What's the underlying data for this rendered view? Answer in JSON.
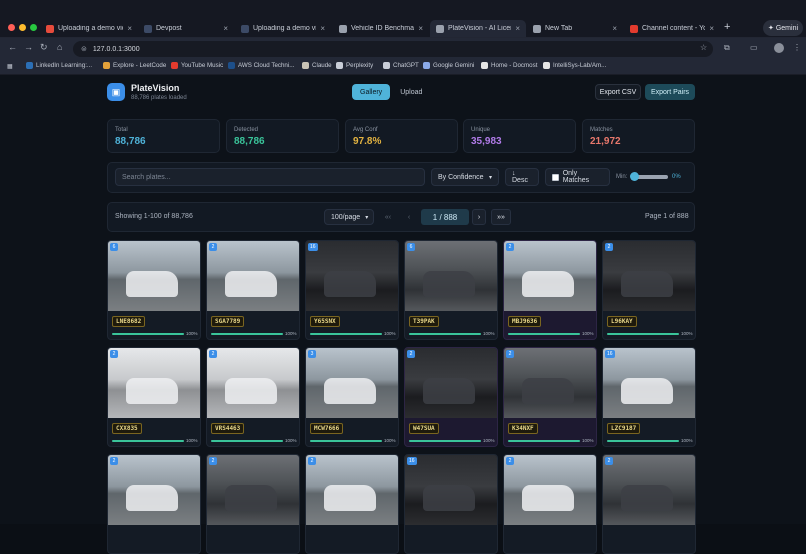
{
  "browser": {
    "tabs": [
      {
        "title": "Uploading a demo video",
        "fav": "#e74b3c",
        "active": false
      },
      {
        "title": "Devpost",
        "fav": "#3c4a66",
        "active": false
      },
      {
        "title": "Uploading a demo video",
        "fav": "#3c4a66",
        "active": false
      },
      {
        "title": "Vehicle ID Benchmark",
        "fav": "#9aa1ad",
        "active": false
      },
      {
        "title": "PlateVision - AI License",
        "fav": "#9aa1ad",
        "active": true
      },
      {
        "title": "New Tab",
        "fav": "#9aa1ad",
        "active": false
      },
      {
        "title": "Channel content - YouTube",
        "fav": "#e33b2e",
        "active": false
      }
    ],
    "new_tab_symbol": "+",
    "gemini_label": "Gemini",
    "url": "127.0.0.1:3000",
    "bookmarks": [
      {
        "label": "LinkedIn Learning:...",
        "color": "#2b6fb6"
      },
      {
        "label": "Explore - LeetCode",
        "color": "#e3a13a"
      },
      {
        "label": "YouTube Music",
        "color": "#e33b2e"
      },
      {
        "label": "AWS Cloud Techni...",
        "color": "#1d4f8a"
      },
      {
        "label": "Claude",
        "color": "#c9c3b6"
      },
      {
        "label": "Perplexity",
        "color": "#c9ced8"
      },
      {
        "label": "ChatGPT",
        "color": "#c9ced8"
      },
      {
        "label": "Google Gemini",
        "color": "#8aa9e8"
      },
      {
        "label": "Home - Docmost",
        "color": "#e6e6e6"
      },
      {
        "label": "IntelliSys-Lab/Am...",
        "color": "#e6e6e6"
      }
    ]
  },
  "app": {
    "title": "PlateVision",
    "subtitle": "88,786 plates loaded",
    "tabs": [
      "Gallery",
      "Upload"
    ],
    "export_csv": "Export CSV",
    "export_pairs": "Export Pairs",
    "stats": [
      {
        "label": "Total",
        "value": "88,786",
        "color": "#4fb3d9"
      },
      {
        "label": "Detected",
        "value": "88,786",
        "color": "#3ac49a"
      },
      {
        "label": "Avg Conf",
        "value": "97.8%",
        "color": "#e3b341"
      },
      {
        "label": "Unique",
        "value": "35,983",
        "color": "#b07be8"
      },
      {
        "label": "Matches",
        "value": "21,972",
        "color": "#e8786c"
      }
    ],
    "search_placeholder": "Search plates...",
    "sort_value": "By Confidence",
    "order_label": "↓ Desc",
    "only_matches_label": "Only Matches",
    "min_label": "Min:",
    "min_value": "0%",
    "showing": "Showing 1-100 of 88,786",
    "per_page": "100/page",
    "page_input": "1 / 888",
    "page_of": "Page 1 of 888",
    "pager_first": "«‹",
    "pager_prev": "‹",
    "pager_next": "›",
    "pager_last": "»»"
  },
  "cards": [
    {
      "badge": "6",
      "plate": "LNE8682",
      "pct": "100%",
      "conf": 1.0,
      "purple": false,
      "scene": "day"
    },
    {
      "badge": "2",
      "plate": "SGA7789",
      "pct": "100%",
      "conf": 1.0,
      "purple": false,
      "scene": "day"
    },
    {
      "badge": "16",
      "plate": "Y65SNX",
      "pct": "100%",
      "conf": 1.0,
      "purple": false,
      "scene": "dark"
    },
    {
      "badge": "6",
      "plate": "T39PAK",
      "pct": "100%",
      "conf": 1.0,
      "purple": false,
      "scene": "garage"
    },
    {
      "badge": "2",
      "plate": "MBJ9636",
      "pct": "100%",
      "conf": 1.0,
      "purple": true,
      "scene": "day"
    },
    {
      "badge": "2",
      "plate": "L96KAY",
      "pct": "100%",
      "conf": 1.0,
      "purple": false,
      "scene": "dark"
    },
    {
      "badge": "2",
      "plate": "CXX835",
      "pct": "100%",
      "conf": 1.0,
      "purple": false,
      "scene": "bw"
    },
    {
      "badge": "2",
      "plate": "VRS4463",
      "pct": "100%",
      "conf": 1.0,
      "purple": false,
      "scene": "bw"
    },
    {
      "badge": "3",
      "plate": "MCW7666",
      "pct": "100%",
      "conf": 1.0,
      "purple": false,
      "scene": "day"
    },
    {
      "badge": "2",
      "plate": "W47SUA",
      "pct": "100%",
      "conf": 1.0,
      "purple": true,
      "scene": "dark"
    },
    {
      "badge": "2",
      "plate": "K34NXF",
      "pct": "100%",
      "conf": 1.0,
      "purple": true,
      "scene": "garage"
    },
    {
      "badge": "16",
      "plate": "LZC9187",
      "pct": "100%",
      "conf": 1.0,
      "purple": false,
      "scene": "day"
    },
    {
      "badge": "2",
      "plate": "",
      "pct": "",
      "conf": 1.0,
      "purple": false,
      "scene": "day"
    },
    {
      "badge": "2",
      "plate": "",
      "pct": "",
      "conf": 1.0,
      "purple": false,
      "scene": "garage"
    },
    {
      "badge": "2",
      "plate": "",
      "pct": "",
      "conf": 1.0,
      "purple": false,
      "scene": "day"
    },
    {
      "badge": "16",
      "plate": "",
      "pct": "",
      "conf": 1.0,
      "purple": false,
      "scene": "dark"
    },
    {
      "badge": "2",
      "plate": "",
      "pct": "",
      "conf": 1.0,
      "purple": false,
      "scene": "day"
    },
    {
      "badge": "2",
      "plate": "",
      "pct": "",
      "conf": 1.0,
      "purple": false,
      "scene": "garage"
    }
  ]
}
